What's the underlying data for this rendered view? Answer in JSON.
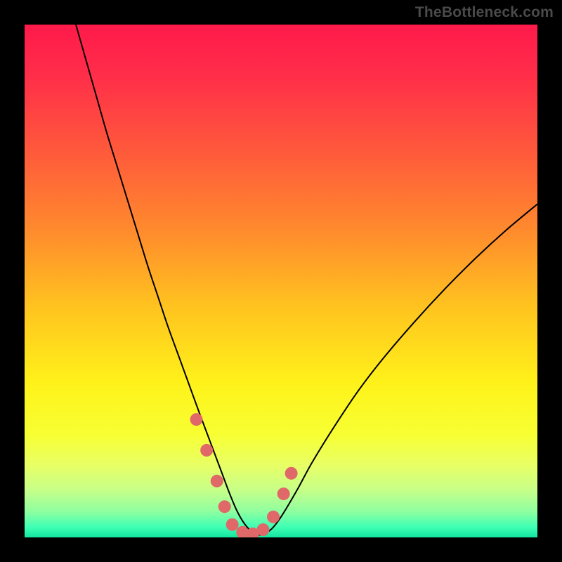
{
  "watermark": "TheBottleneck.com",
  "chart_data": {
    "type": "line",
    "title": "",
    "xlabel": "",
    "ylabel": "",
    "xlim": [
      0,
      100
    ],
    "ylim": [
      0,
      100
    ],
    "background_gradient_stops": [
      {
        "offset": 0.0,
        "color": "#ff1a4b"
      },
      {
        "offset": 0.1,
        "color": "#ff2e49"
      },
      {
        "offset": 0.25,
        "color": "#ff5a3b"
      },
      {
        "offset": 0.4,
        "color": "#ff8a2d"
      },
      {
        "offset": 0.55,
        "color": "#ffc31f"
      },
      {
        "offset": 0.7,
        "color": "#fff21a"
      },
      {
        "offset": 0.8,
        "color": "#f7ff33"
      },
      {
        "offset": 0.86,
        "color": "#e8ff66"
      },
      {
        "offset": 0.91,
        "color": "#c4ff8a"
      },
      {
        "offset": 0.95,
        "color": "#8effa0"
      },
      {
        "offset": 0.98,
        "color": "#3effb4"
      },
      {
        "offset": 1.0,
        "color": "#12e6a0"
      }
    ],
    "series": [
      {
        "name": "bottleneck-curve",
        "color": "#000000",
        "stroke_width": 2,
        "x": [
          10.0,
          12.0,
          14.0,
          16.0,
          18.0,
          20.0,
          22.0,
          24.0,
          26.0,
          28.0,
          30.0,
          32.0,
          34.0,
          35.5,
          37.0,
          38.5,
          40.0,
          41.5,
          43.0,
          44.5,
          46.0,
          48.0,
          50.0,
          53.0,
          56.0,
          60.0,
          65.0,
          70.0,
          76.0,
          82.0,
          88.0,
          94.0,
          100.0
        ],
        "y": [
          100.0,
          93.0,
          86.0,
          79.0,
          72.5,
          66.0,
          59.5,
          53.0,
          47.0,
          41.0,
          35.5,
          30.0,
          24.5,
          20.5,
          16.5,
          12.5,
          8.5,
          5.0,
          2.5,
          1.0,
          0.5,
          1.5,
          4.0,
          9.0,
          14.5,
          21.0,
          28.5,
          35.0,
          42.0,
          48.5,
          54.5,
          60.0,
          65.0
        ]
      },
      {
        "name": "highlight-dots",
        "color": "#e06868",
        "marker_radius": 9,
        "points": [
          {
            "x": 33.5,
            "y": 23.0
          },
          {
            "x": 35.5,
            "y": 17.0
          },
          {
            "x": 37.5,
            "y": 11.0
          },
          {
            "x": 39.0,
            "y": 6.0
          },
          {
            "x": 40.5,
            "y": 2.5
          },
          {
            "x": 42.5,
            "y": 1.0
          },
          {
            "x": 44.5,
            "y": 0.7
          },
          {
            "x": 46.5,
            "y": 1.5
          },
          {
            "x": 48.5,
            "y": 4.0
          },
          {
            "x": 50.5,
            "y": 8.5
          },
          {
            "x": 52.0,
            "y": 12.5
          }
        ]
      }
    ]
  }
}
